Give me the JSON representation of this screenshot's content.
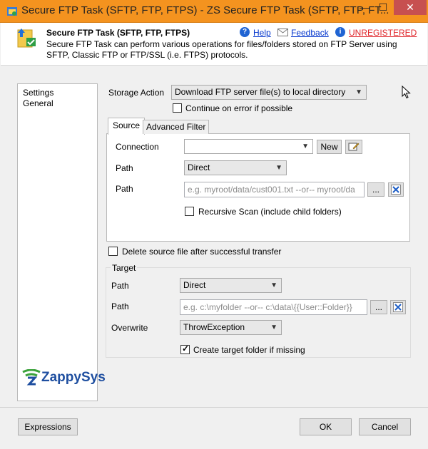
{
  "window": {
    "title": "Secure FTP Task (SFTP, FTP, FTPS) - ZS Secure FTP Task (SFTP, FTP, FT...",
    "minimize": "—",
    "maximize": "☐",
    "close": "✕"
  },
  "header": {
    "title": "Secure FTP Task (SFTP, FTP, FTPS)",
    "description": "Secure FTP Task can perform various operations for files/folders stored on FTP Server using SFTP, Classic FTP or FTP/SSL (i.e. FTPS) protocols.",
    "help": "Help",
    "feedback": "Feedback",
    "unregistered": "UNREGISTERED",
    "help_glyph": "?",
    "info_glyph": "i"
  },
  "nav": {
    "items": [
      "Settings",
      "General"
    ]
  },
  "storage": {
    "label": "Storage Action",
    "value": "Download FTP server file(s) to local directory",
    "continue_label": "Continue on error if possible",
    "continue_checked": false
  },
  "tabs": {
    "source": "Source",
    "advanced": "Advanced Filter"
  },
  "source": {
    "connection_label": "Connection",
    "connection_value": "",
    "new_button": "New",
    "path_type_label": "Path",
    "path_type_value": "Direct",
    "path_label": "Path",
    "path_placeholder": "e.g. myroot/data/cust001.txt --or-- myroot/da",
    "browse": "...",
    "recursive_label": "Recursive Scan (include child folders)",
    "recursive_checked": false
  },
  "delete_label": "Delete source file after successful transfer",
  "target": {
    "group_label": "Target",
    "path_type_label": "Path",
    "path_type_value": "Direct",
    "path_label": "Path",
    "path_placeholder": "e.g. c:\\myfolder --or-- c:\\data\\{{User::Folder}}",
    "browse": "...",
    "overwrite_label": "Overwrite",
    "overwrite_value": "ThrowException",
    "create_label": "Create target folder if missing",
    "create_checked": true
  },
  "brand": {
    "name": "ZappySys"
  },
  "footer": {
    "expressions": "Expressions",
    "ok": "OK",
    "cancel": "Cancel"
  },
  "colors": {
    "titlebar": "#f4931f",
    "brand_blue": "#1f4fa0",
    "brand_green": "#3ba23b",
    "unregistered": "#e0262b"
  }
}
